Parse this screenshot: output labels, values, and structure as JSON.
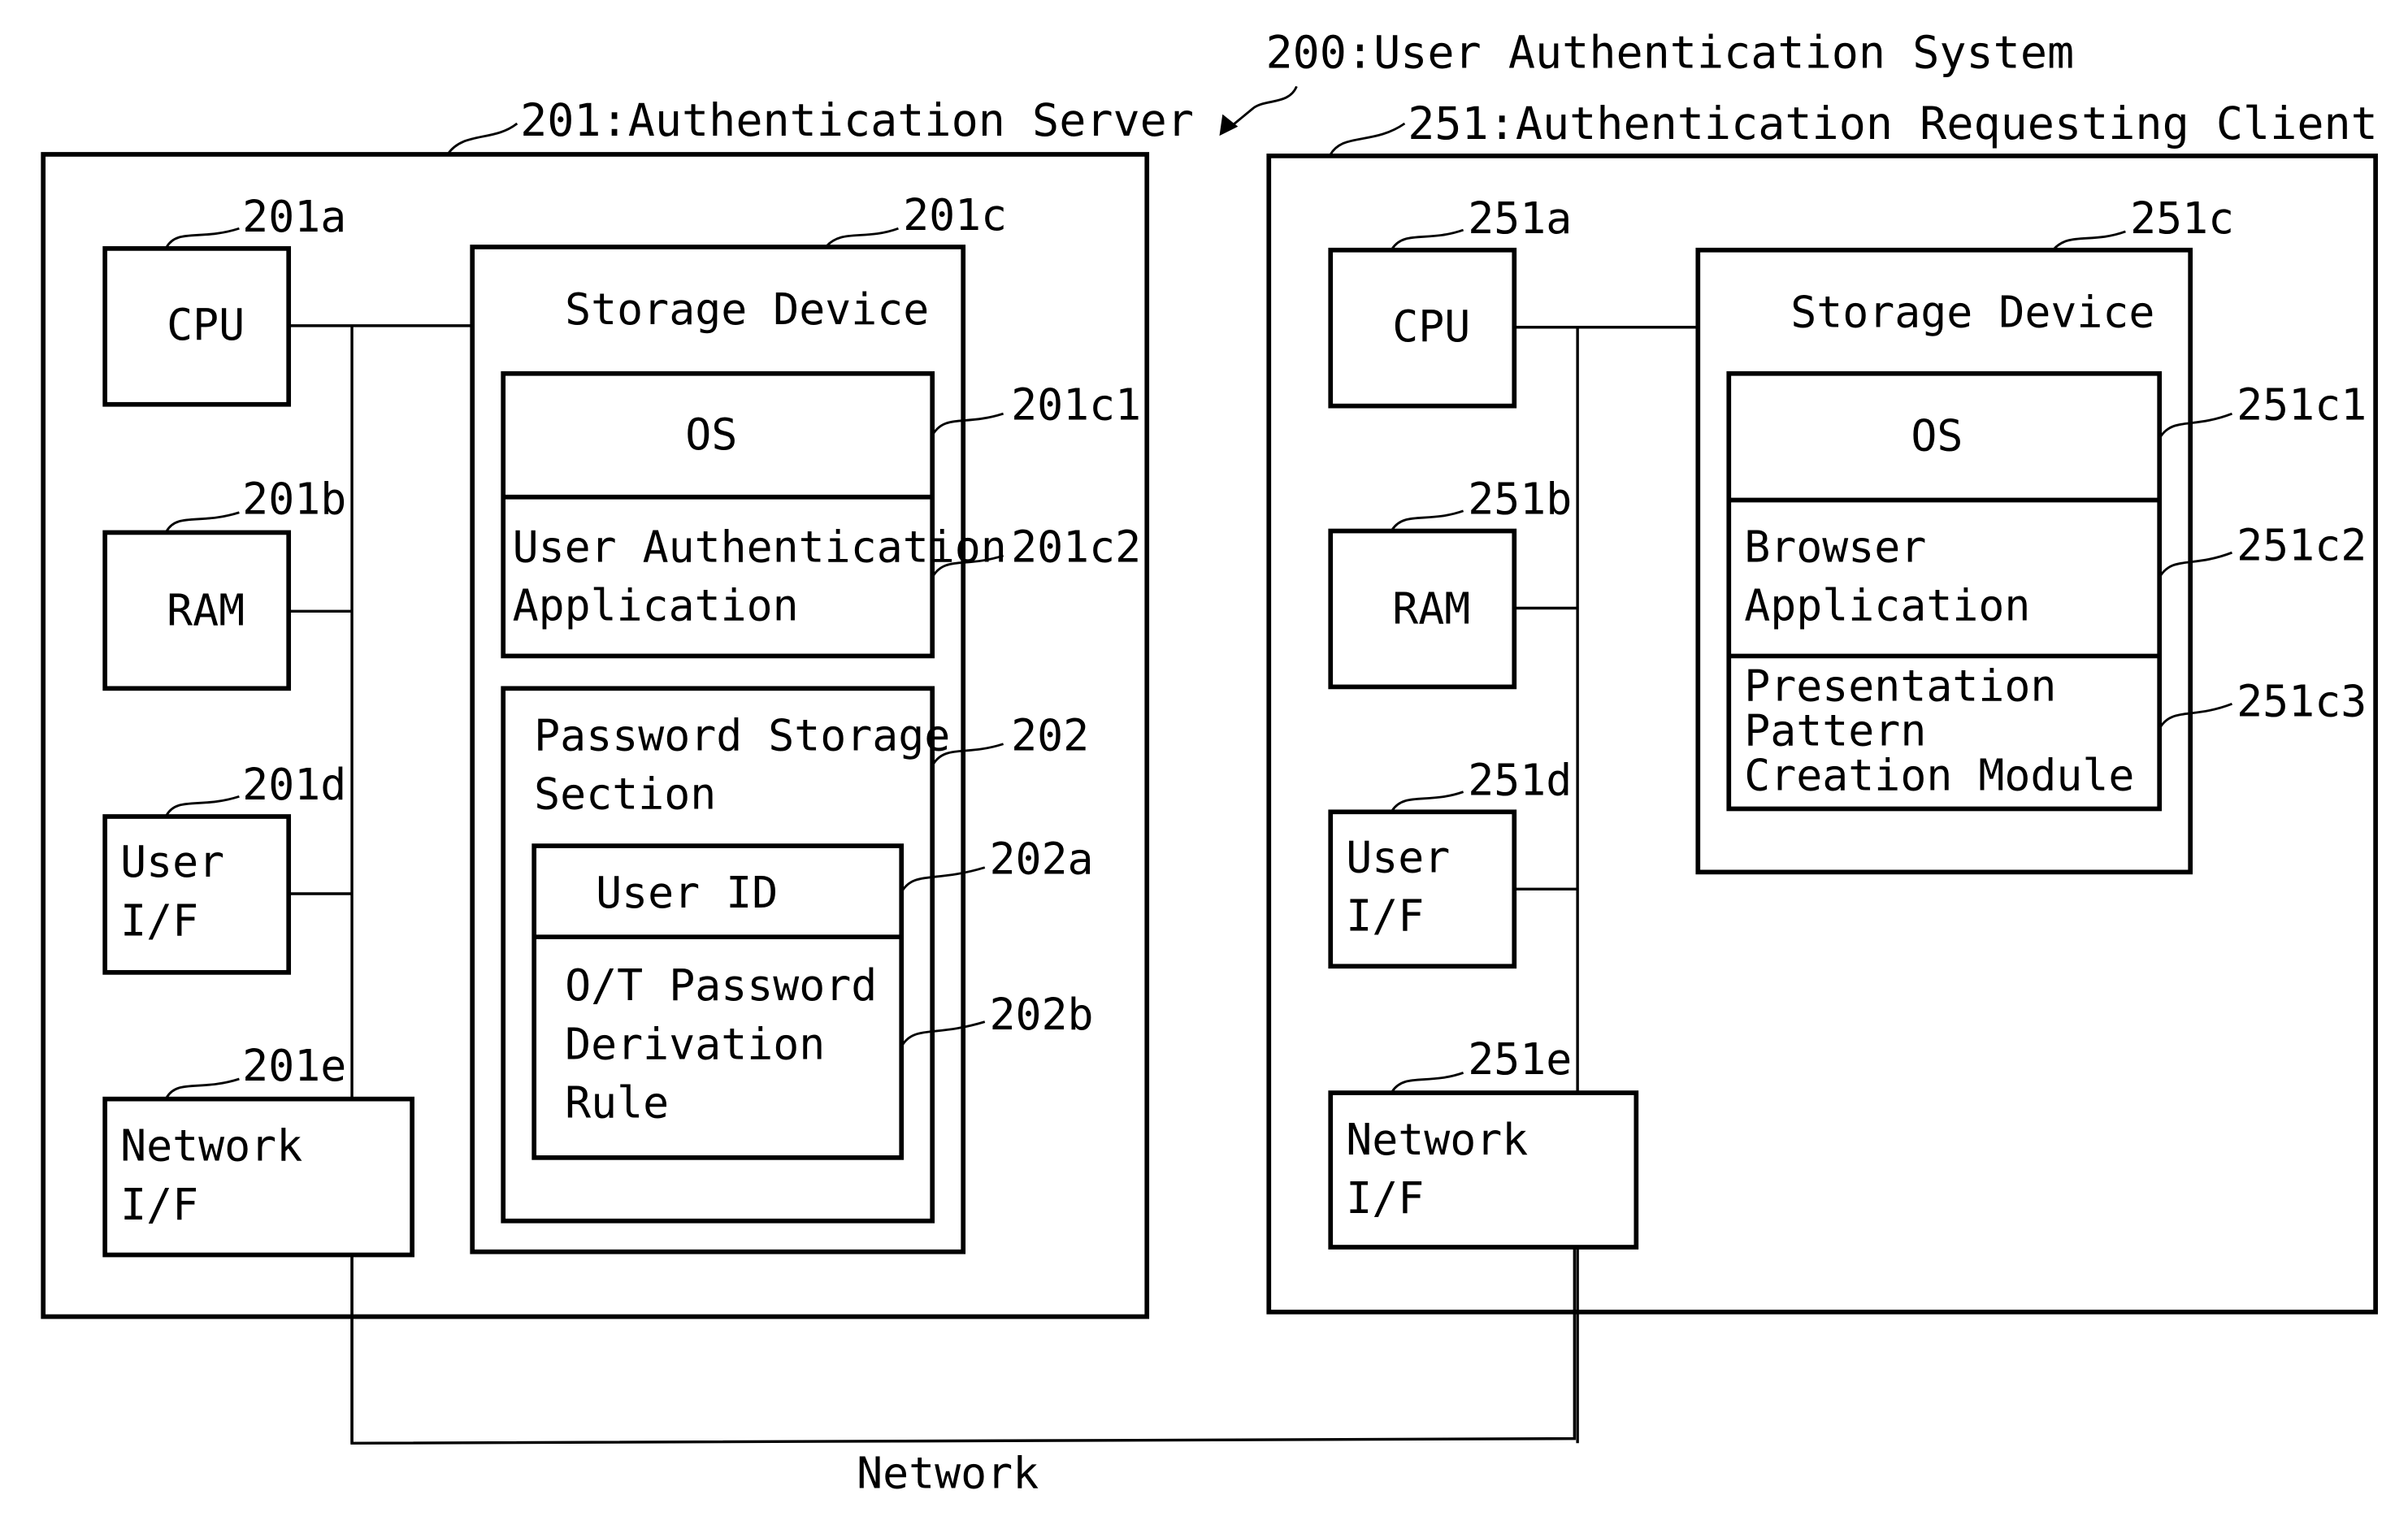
{
  "system": {
    "label": "200:User Authentication System"
  },
  "server": {
    "label": "201:Authentication Server",
    "cpu": {
      "ref": "201a",
      "label": "CPU"
    },
    "ram": {
      "ref": "201b",
      "label": "RAM"
    },
    "user_if": {
      "ref": "201d",
      "lines": [
        "User",
        "I/F"
      ]
    },
    "network_if": {
      "ref": "201e",
      "lines": [
        "Network",
        "I/F"
      ]
    },
    "storage": {
      "ref": "201c",
      "label": "Storage Device",
      "os": {
        "ref": "201c1",
        "label": "OS"
      },
      "app": {
        "ref": "201c2",
        "lines": [
          "User Authentication",
          "Application"
        ]
      },
      "password_section": {
        "ref": "202",
        "lines": [
          "Password Storage",
          "Section"
        ],
        "user_id": {
          "ref": "202a",
          "label": "User ID"
        },
        "rule": {
          "ref": "202b",
          "lines": [
            "O/T Password",
            "Derivation",
            "Rule"
          ]
        }
      }
    }
  },
  "client": {
    "label": "251:Authentication Requesting Client",
    "cpu": {
      "ref": "251a",
      "label": "CPU"
    },
    "ram": {
      "ref": "251b",
      "label": "RAM"
    },
    "user_if": {
      "ref": "251d",
      "lines": [
        "User",
        "I/F"
      ]
    },
    "network_if": {
      "ref": "251e",
      "lines": [
        "Network",
        "I/F"
      ]
    },
    "storage": {
      "ref": "251c",
      "label": "Storage Device",
      "os": {
        "ref": "251c1",
        "label": "OS"
      },
      "browser": {
        "ref": "251c2",
        "lines": [
          "Browser",
          "Application"
        ]
      },
      "module": {
        "ref": "251c3",
        "lines": [
          "Presentation",
          "Pattern",
          "Creation Module"
        ]
      }
    }
  },
  "network": {
    "label": "Network"
  }
}
